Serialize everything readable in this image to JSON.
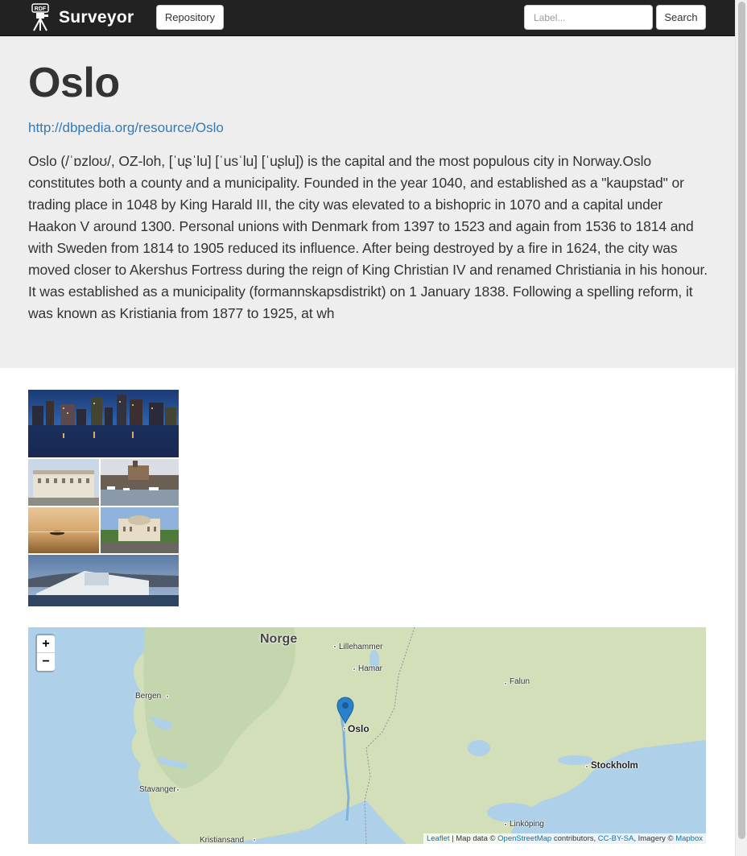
{
  "navbar": {
    "brand_name": "Surveyor",
    "logo_text": "RDF",
    "repository_label": "Repository",
    "search_placeholder": "Label...",
    "search_button": "Search"
  },
  "resource": {
    "title": "Oslo",
    "uri": "http://dbpedia.org/resource/Oslo",
    "abstract": "Oslo (/ˈɒzloʊ/, OZ-loh, [ˈuʂˈlu] [ˈusˈlu] [ˈuʂlu]) is the capital and the most populous city in Norway.Oslo constitutes both a county and a municipality. Founded in the year 1040, and established as a \"kaupstad\" or trading place in 1048 by King Harald III, the city was elevated to a bishopric in 1070 and a capital under Haakon V around 1300. Personal unions with Denmark from 1397 to 1523 and again from 1536 to 1814 and with Sweden from 1814 to 1905 reduced its influence. After being destroyed by a fire in 1624, the city was moved closer to Akershus Fortress during the reign of King Christian IV and renamed Christiania in his honour. It was established as a municipality (formannskapsdistrikt) on 1 January 1838. Following a spelling reform, it was known as Kristiania from 1877 to 1925, at wh"
  },
  "map": {
    "zoom_in": "+",
    "zoom_out": "−",
    "labels": {
      "norge": "Norge",
      "lillehammer": "Lillehammer",
      "hamar": "Hamar",
      "bergen": "Bergen",
      "falun": "Falun",
      "oslo": "Oslo",
      "stockholm": "Stockholm",
      "stavanger": "Stavanger",
      "linkoping": "Linköping",
      "kristiansand": "Kristiansand"
    },
    "attribution": {
      "leaflet": "Leaflet",
      "sep1": " | Map data © ",
      "osm": "OpenStreetMap",
      "contributors": " contributors, ",
      "license": "CC-BY-SA",
      "imagery": ", Imagery © ",
      "mapbox": "Mapbox"
    },
    "marker_color": "#2a81cb"
  },
  "colors": {
    "navbar": "#222222",
    "jumbotron": "#eeeeee",
    "link": "#337ab7"
  }
}
